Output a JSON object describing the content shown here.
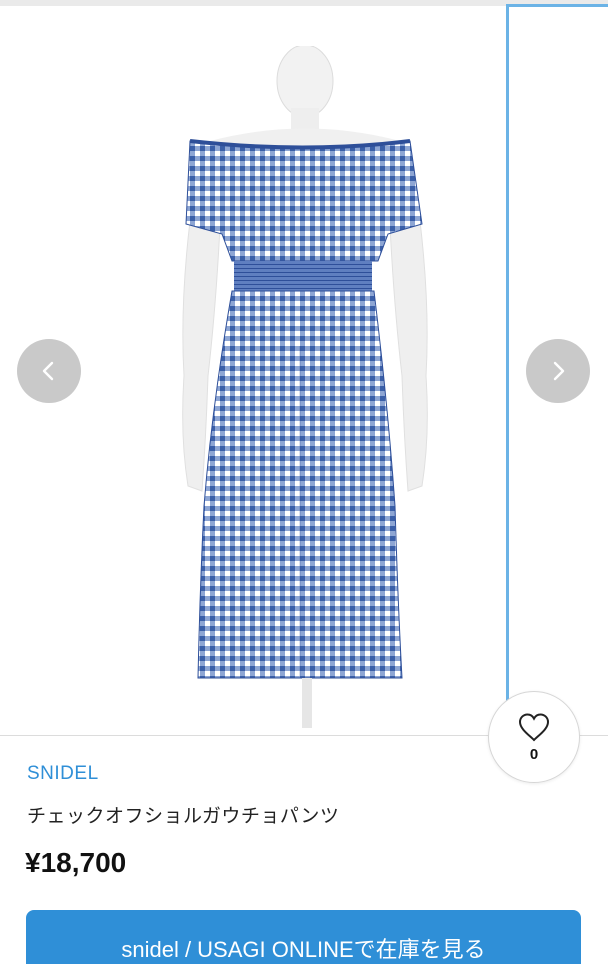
{
  "product": {
    "brand": "SNIDEL",
    "name": "チェックオフショルガウチョパンツ",
    "price": "¥18,700",
    "favorite_count": "0",
    "image_icon": "gingham-dress-photo"
  },
  "carousel": {
    "prev_icon": "chevron-left-icon",
    "next_icon": "chevron-right-icon"
  },
  "cta": {
    "label": "snidel / USAGI ONLINEで在庫を見る"
  },
  "colors": {
    "accent": "#2f8fd7",
    "carousel_border": "#6bb3e6",
    "gingham_blue": "#3a5fa8"
  }
}
